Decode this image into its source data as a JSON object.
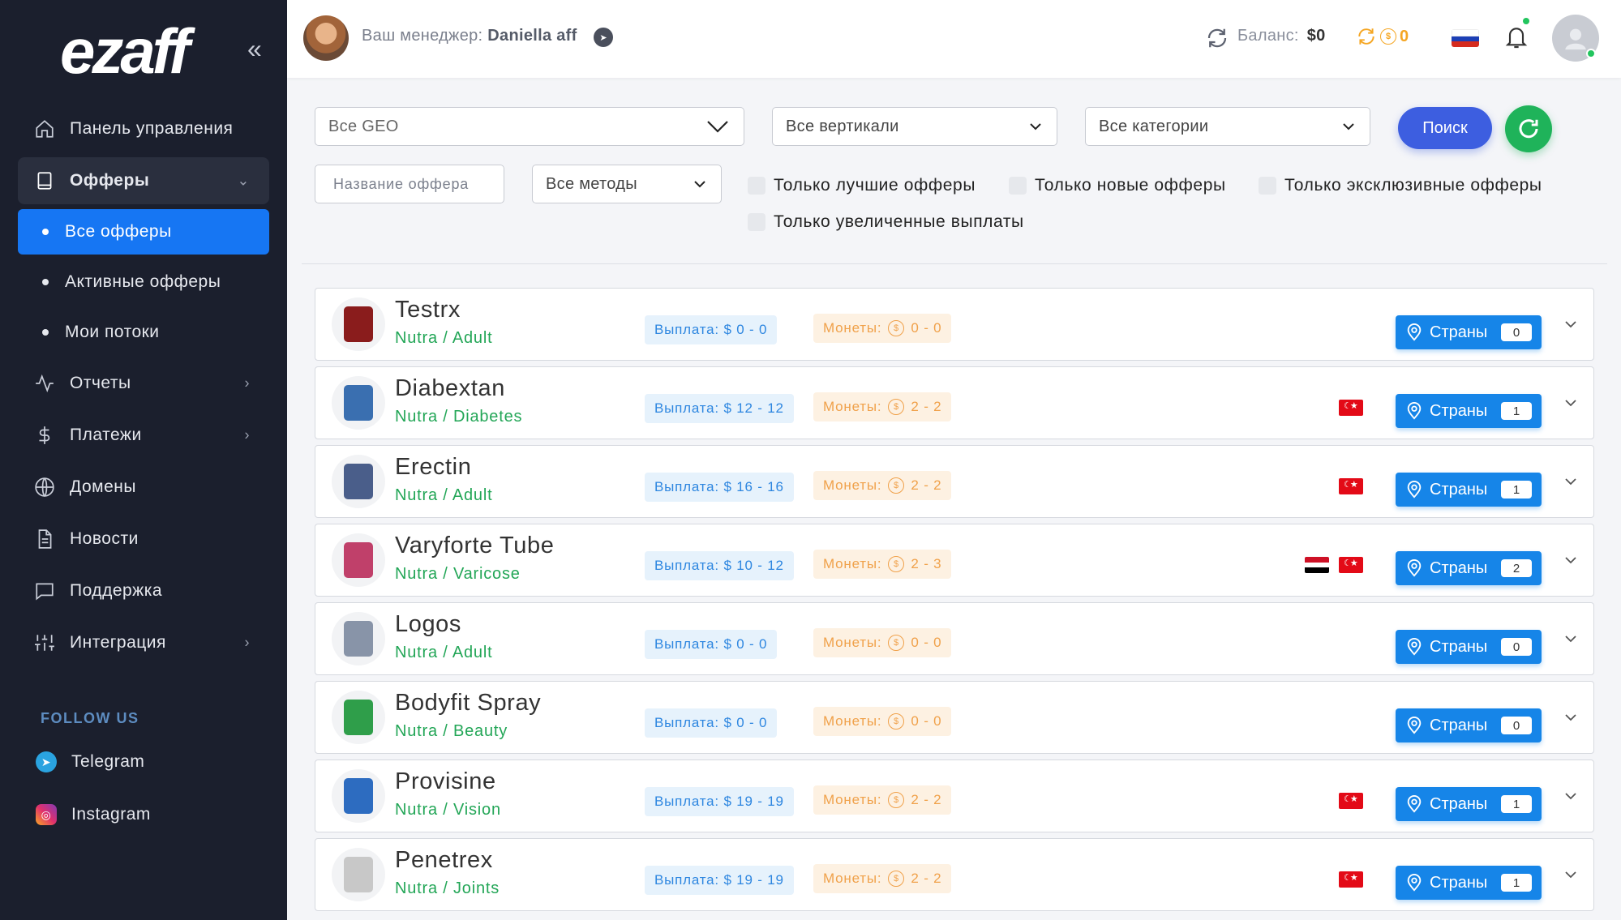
{
  "sidebar": {
    "logo": "ezaff",
    "nav": [
      {
        "label": "Панель управления",
        "icon": "home-icon"
      },
      {
        "label": "Офферы",
        "icon": "tablet-icon"
      },
      {
        "label": "Отчеты",
        "icon": "activity-icon"
      },
      {
        "label": "Платежи",
        "icon": "dollar-icon"
      },
      {
        "label": "Домены",
        "icon": "globe-icon"
      },
      {
        "label": "Новости",
        "icon": "document-icon"
      },
      {
        "label": "Поддержка",
        "icon": "chat-icon"
      },
      {
        "label": "Интеграция",
        "icon": "sliders-icon"
      }
    ],
    "sub": [
      {
        "label": "Все офферы"
      },
      {
        "label": "Активные офферы"
      },
      {
        "label": "Мои потоки"
      }
    ],
    "follow_title": "FOLLOW US",
    "social": [
      {
        "label": "Telegram",
        "icon": "telegram-icon"
      },
      {
        "label": "Instagram",
        "icon": "instagram-icon"
      }
    ]
  },
  "topbar": {
    "manager_label": "Ваш менеджер:",
    "manager_name": "Daniella aff",
    "balance_label": "Баланс:",
    "balance_value": "$0",
    "coins_value": "0"
  },
  "filters": {
    "geo": "Все GEO",
    "verticals": "Все вертикали",
    "categories": "Все категории",
    "search_button": "Поиск",
    "offer_name_placeholder": "Название оффера",
    "methods": "Все методы",
    "checkboxes": [
      "Только лучшие офферы",
      "Только новые офферы",
      "Только эксклюзивные офферы",
      "Только увеличенные выплаты"
    ]
  },
  "offer_labels": {
    "payout_prefix": "Выплата:",
    "coins_prefix": "Монеты:",
    "countries": "Страны"
  },
  "offers": [
    {
      "name": "Testrx",
      "category": "Nutra / Adult",
      "payout": "$ 0 - 0",
      "coins": "0 - 0",
      "countries_count": "0",
      "flags": []
    },
    {
      "name": "Diabextan",
      "category": "Nutra / Diabetes",
      "payout": "$ 12 - 12",
      "coins": "2 - 2",
      "countries_count": "1",
      "flags": [
        "TR"
      ]
    },
    {
      "name": "Erectin",
      "category": "Nutra / Adult",
      "payout": "$ 16 - 16",
      "coins": "2 - 2",
      "countries_count": "1",
      "flags": [
        "TR"
      ]
    },
    {
      "name": "Varyforte Tube",
      "category": "Nutra / Varicose",
      "payout": "$ 10 - 12",
      "coins": "2 - 3",
      "countries_count": "2",
      "flags": [
        "IQ",
        "TR"
      ]
    },
    {
      "name": "Logos",
      "category": "Nutra / Adult",
      "payout": "$ 0 - 0",
      "coins": "0 - 0",
      "countries_count": "0",
      "flags": []
    },
    {
      "name": "Bodyfit Spray",
      "category": "Nutra / Beauty",
      "payout": "$ 0 - 0",
      "coins": "0 - 0",
      "countries_count": "0",
      "flags": []
    },
    {
      "name": "Provisine",
      "category": "Nutra / Vision",
      "payout": "$ 19 - 19",
      "coins": "2 - 2",
      "countries_count": "1",
      "flags": [
        "TR"
      ]
    },
    {
      "name": "Penetrex",
      "category": "Nutra / Joints",
      "payout": "$ 19 - 19",
      "coins": "2 - 2",
      "countries_count": "1",
      "flags": [
        "TR"
      ]
    }
  ],
  "colors": {
    "sidebar_bg": "#1b1f2d",
    "active_blue": "#1676f3",
    "search_blue": "#3d5ee0",
    "refresh_green": "#1fb35a",
    "category_green": "#23a657",
    "coins_orange": "#f0a14a"
  }
}
